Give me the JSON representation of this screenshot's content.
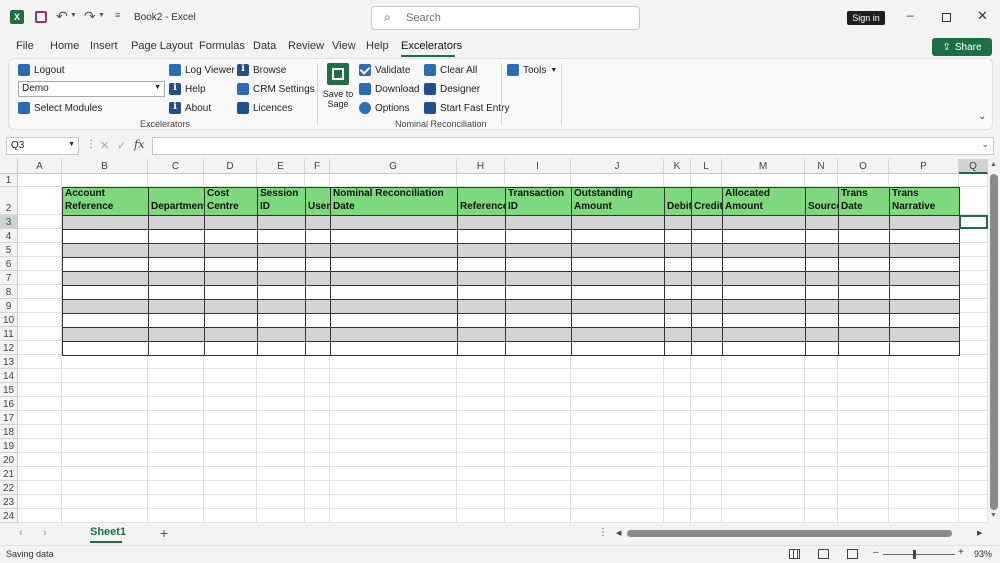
{
  "title": {
    "doc_name": "Book2",
    "separator": "-",
    "app_name": "Excel",
    "search_placeholder": "Search",
    "sign_in": "Sign in"
  },
  "tabs": [
    "File",
    "Home",
    "Insert",
    "Page Layout",
    "Formulas",
    "Data",
    "Review",
    "View",
    "Help",
    "Excelerators"
  ],
  "active_tab": "Excelerators",
  "share": "Share",
  "ribbon": {
    "excelerators_group": {
      "label": "Excelerators",
      "logout": "Logout",
      "dropdown_value": "Demo",
      "select_modules": "Select Modules",
      "log_viewer": "Log Viewer",
      "help": "Help",
      "about": "About",
      "browse": "Browse",
      "crm_settings": "CRM Settings",
      "licences": "Licences"
    },
    "nominal_group": {
      "label": "Nominal Reconciliation",
      "save_line1": "Save to",
      "save_line2": "Sage",
      "validate": "Validate",
      "download": "Download",
      "options": "Options",
      "clear_all": "Clear All",
      "designer": "Designer",
      "start_fast_entry": "Start Fast Entry"
    },
    "tools": "Tools"
  },
  "formula_bar": {
    "name_box": "Q3",
    "fx": "fx",
    "content": ""
  },
  "columns": [
    "A",
    "B",
    "C",
    "D",
    "E",
    "F",
    "G",
    "H",
    "I",
    "J",
    "K",
    "L",
    "M",
    "N",
    "O",
    "P",
    "Q"
  ],
  "rows": [
    "1",
    "2",
    "3",
    "4",
    "5",
    "6",
    "7",
    "8",
    "9",
    "10",
    "11",
    "12",
    "13",
    "14",
    "15",
    "16",
    "17",
    "18",
    "19",
    "20",
    "21",
    "22",
    "23",
    "24"
  ],
  "table_headers": [
    {
      "line1": "",
      "line2": "Account Reference"
    },
    {
      "line1": "",
      "line2": "Department"
    },
    {
      "line1": "",
      "line2": "Cost Centre"
    },
    {
      "line1": "Session",
      "line2": "ID"
    },
    {
      "line1": "",
      "line2": "User"
    },
    {
      "line1": "",
      "line2": "Nominal Reconciliation Date"
    },
    {
      "line1": "",
      "line2": "Reference"
    },
    {
      "line1": "Transaction",
      "line2": "ID"
    },
    {
      "line1": "Outstanding",
      "line2": "Amount"
    },
    {
      "line1": "",
      "line2": "Debit"
    },
    {
      "line1": "",
      "line2": "Credit"
    },
    {
      "line1": "",
      "line2": "Allocated Amount"
    },
    {
      "line1": "",
      "line2": "Source"
    },
    {
      "line1": "",
      "line2": "Trans Date"
    },
    {
      "line1": "",
      "line2": "Trans Narrative"
    }
  ],
  "table_header_color": "#7ed97e",
  "band_color": "#d3d3d3",
  "sheet_tab": "Sheet1",
  "status": {
    "text": "Saving data",
    "zoom": "93%"
  }
}
